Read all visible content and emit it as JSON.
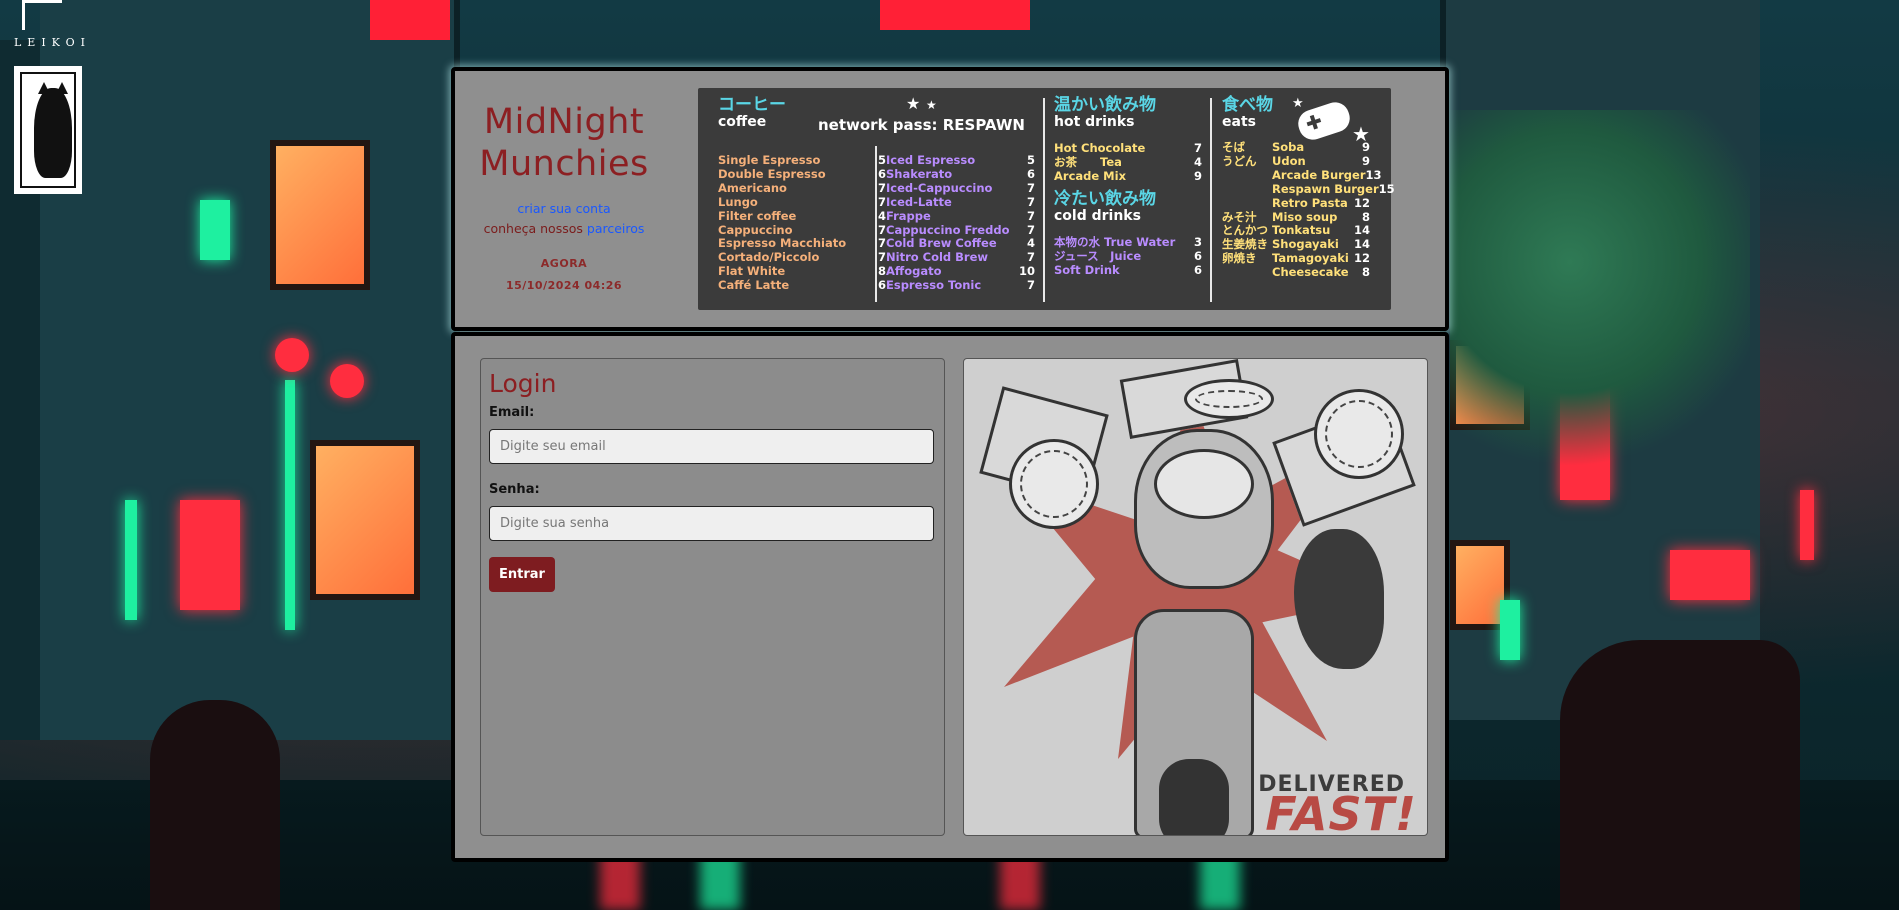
{
  "logo": {
    "text": "LEIKOI"
  },
  "brand": {
    "title_line1": "MidNight",
    "title_line2": "Munchies",
    "create_account": "criar sua conta",
    "partners_prefix": "conheça nossos",
    "partners_link": "parceiros",
    "now_label": "AGORA",
    "now_value": "15/10/2024 04:26"
  },
  "menu": {
    "coffee": {
      "jp": "コーヒー",
      "en": "coffee",
      "pass": "network pass: RESPAWN",
      "col1": [
        {
          "name": "Single Espresso",
          "price": "5"
        },
        {
          "name": "Double Espresso",
          "price": "6"
        },
        {
          "name": "Americano",
          "price": "7"
        },
        {
          "name": "Lungo",
          "price": "7"
        },
        {
          "name": "Filter coffee",
          "price": "4"
        },
        {
          "name": "Cappuccino",
          "price": "7"
        },
        {
          "name": "Espresso Macchiato",
          "price": "7"
        },
        {
          "name": "Cortado/Piccolo",
          "price": "7"
        },
        {
          "name": "Flat White",
          "price": "8"
        },
        {
          "name": "Caffé Latte",
          "price": "6"
        }
      ],
      "col2": [
        {
          "name": "Iced Espresso",
          "price": "5"
        },
        {
          "name": "Shakerato",
          "price": "6"
        },
        {
          "name": "Iced-Cappuccino",
          "price": "7"
        },
        {
          "name": "Iced-Latte",
          "price": "7"
        },
        {
          "name": "Frappe",
          "price": "7"
        },
        {
          "name": "Cappuccino Freddo",
          "price": "7"
        },
        {
          "name": "Cold Brew Coffee",
          "price": "4"
        },
        {
          "name": "Nitro Cold Brew",
          "price": "7"
        },
        {
          "name": "Affogato",
          "price": "10"
        },
        {
          "name": "Espresso Tonic",
          "price": "7"
        }
      ]
    },
    "hot": {
      "jp": "温かい飲み物",
      "en": "hot drinks",
      "items": [
        {
          "name": "Hot Chocolate",
          "price": "7"
        },
        {
          "name": "お茶　　Tea",
          "price": "4"
        },
        {
          "name": "Arcade Mix",
          "price": "9"
        }
      ]
    },
    "cold": {
      "jp": "冷たい飲み物",
      "en": "cold drinks",
      "items": [
        {
          "name": "本物の水 True Water",
          "price": "3"
        },
        {
          "name": "ジュース　Juice",
          "price": "6"
        },
        {
          "name": "Soft Drink",
          "price": "6"
        }
      ]
    },
    "eats": {
      "jp": "食べ物",
      "en": "eats",
      "items": [
        {
          "jp": "そば",
          "name": "Soba",
          "price": "9"
        },
        {
          "jp": "うどん",
          "name": "Udon",
          "price": "9"
        },
        {
          "jp": "",
          "name": "Arcade Burger",
          "price": "13"
        },
        {
          "jp": "",
          "name": "Respawn Burger",
          "price": "15"
        },
        {
          "jp": "",
          "name": "Retro Pasta",
          "price": "12"
        },
        {
          "jp": "みそ汁",
          "name": "Miso soup",
          "price": "8"
        },
        {
          "jp": "とんかつ",
          "name": "Tonkatsu",
          "price": "14"
        },
        {
          "jp": "生姜焼き",
          "name": "Shogayaki",
          "price": "14"
        },
        {
          "jp": "卵焼き",
          "name": "Tamagoyaki",
          "price": "12"
        },
        {
          "jp": "",
          "name": "Cheesecake",
          "price": "8"
        }
      ]
    }
  },
  "login": {
    "title": "Login",
    "email_label": "Email:",
    "email_placeholder": "Digite seu email",
    "password_label": "Senha:",
    "password_placeholder": "Digite sua senha",
    "submit": "Entrar"
  },
  "poster": {
    "line1": "DELIVERED",
    "line2": "FAST!"
  },
  "colors": {
    "brand_red": "#8c1f22",
    "link_blue": "#1a58ff",
    "menu_bg": "#3b3b3b",
    "panel_bg": "#8f8f8f",
    "button_bg": "#7e1c20"
  }
}
